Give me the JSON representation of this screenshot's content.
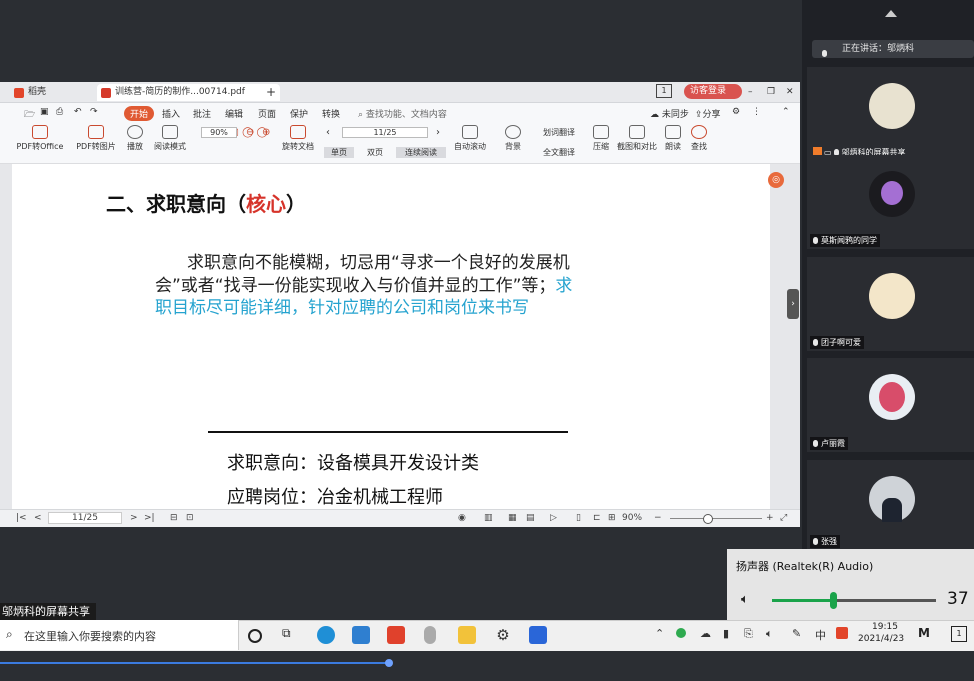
{
  "wps": {
    "tabs": [
      "稻壳",
      "训练营-简历的制作...00714.pdf"
    ],
    "visitor_login": "访客登录",
    "menus": [
      "开始",
      "插入",
      "批注",
      "编辑",
      "页面",
      "保护",
      "转换"
    ],
    "search_placeholder": "查找功能、文档内容",
    "unsynced": "未同步",
    "share": "分享",
    "tools": [
      "PDF转Office",
      "PDF转图片",
      "播放",
      "阅读模式",
      "旋转文档",
      "单页",
      "双页",
      "连续阅读",
      "自动滚动",
      "背景",
      "划词翻译",
      "全文翻译",
      "压缩",
      "截图和对比",
      "朗读",
      "查找"
    ],
    "zoom": "90%",
    "page_indicator": "11/25"
  },
  "slide": {
    "heading_prefix": "二、求职意向（",
    "heading_highlight": "核心",
    "heading_suffix": "）",
    "paragraph_line1": "求职意向不能模糊，切忌用“寻求一个良好的发展机",
    "paragraph_line2_black": "会”或者“找寻一份能实现收入与价值并显的工作”等；",
    "paragraph_line2_blue": "求",
    "paragraph_line3_blue": "职目标尽可能详细，针对应聘的公司和岗位来书写",
    "item1": "求职意向：设备模具开发设计类",
    "item2": "应聘岗位：冶金机械工程师"
  },
  "status": {
    "page": "11/25",
    "zoom": "90%"
  },
  "panel": {
    "speaking": "正在讲话：邬炳科",
    "participants": [
      "邬炳科的屏幕共享",
      "莫斯闻鸦的同学",
      "团子啊可爱",
      "卢丽霞",
      "张强"
    ]
  },
  "volume": {
    "device": "扬声器 (Realtek(R) Audio)",
    "level": "37",
    "fraction": 0.37
  },
  "share_label": "邬炳科的屏幕共享",
  "taskbar": {
    "search_placeholder": "在这里输入你要搜索的内容",
    "ime": "中",
    "time": "19:15",
    "date": "2021/4/23",
    "notifications": "1"
  },
  "colors": {
    "accent_red": "#d6332a",
    "accent_blue": "#25a3cf",
    "wps_orange": "#e05a33"
  }
}
